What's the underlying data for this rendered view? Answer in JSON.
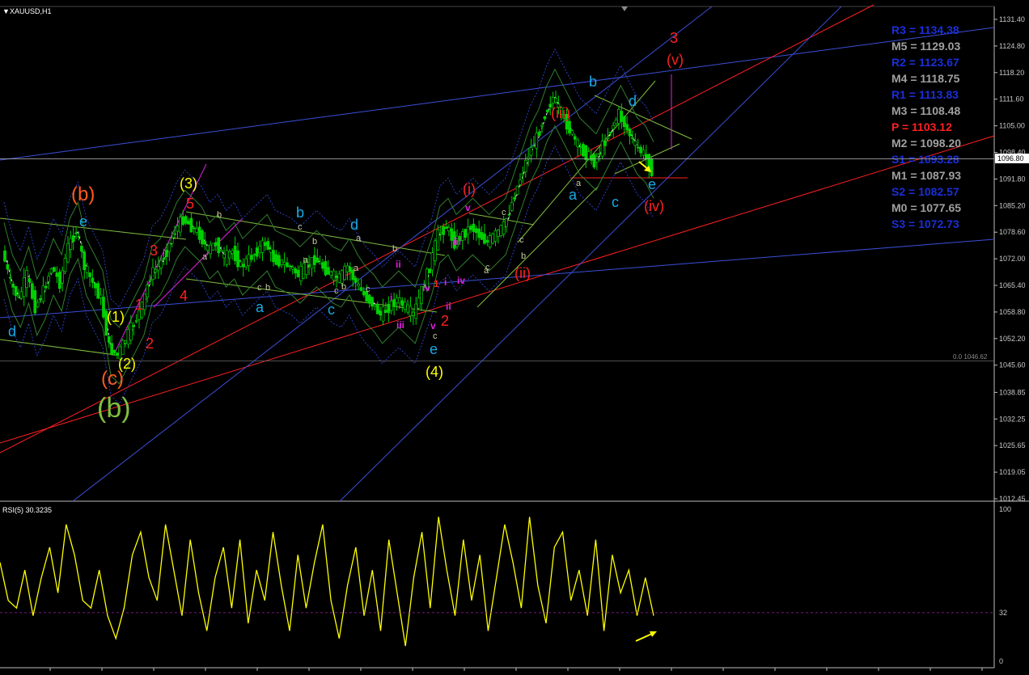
{
  "chart_data": [
    {
      "type": "line",
      "title": "XAUUSD,H1",
      "ylim": [
        1010,
        1136
      ],
      "y_ticks": [
        "1131.40",
        "1124.80",
        "1118.20",
        "1111.60",
        "1105.00",
        "1098.40",
        "1091.80",
        "1085.20",
        "1078.60",
        "1072.00",
        "1065.40",
        "1058.80",
        "1052.20",
        "1045.60",
        "1038.85",
        "1032.25",
        "1025.65",
        "1019.05",
        "1012.45"
      ],
      "current_price_label": "1096.80",
      "current_price": 1096.8,
      "level_marker": "0.0 1046.62",
      "level_value": 1046.62,
      "pivot_levels": [
        {
          "label": "R3 = 1134.38",
          "value": 1134.38,
          "color": "#1a2fd8"
        },
        {
          "label": "M5 = 1129.03",
          "value": 1129.03,
          "color": "#a0a0a0"
        },
        {
          "label": "R2 = 1123.67",
          "value": 1123.67,
          "color": "#1a2fd8"
        },
        {
          "label": "M4 = 1118.75",
          "value": 1118.75,
          "color": "#a0a0a0"
        },
        {
          "label": "R1 = 1113.83",
          "value": 1113.83,
          "color": "#1a2fd8"
        },
        {
          "label": "M3 = 1108.48",
          "value": 1108.48,
          "color": "#a0a0a0"
        },
        {
          "label": "P  = 1103.12",
          "value": 1103.12,
          "color": "#ff2020"
        },
        {
          "label": "M2 = 1098.20",
          "value": 1098.2,
          "color": "#a0a0a0"
        },
        {
          "label": "S1 = 1093.28",
          "value": 1093.28,
          "color": "#1a2fd8"
        },
        {
          "label": "M1 = 1087.93",
          "value": 1087.93,
          "color": "#a0a0a0"
        },
        {
          "label": "S2 = 1082.57",
          "value": 1082.57,
          "color": "#1a2fd8"
        },
        {
          "label": "M0 = 1077.65",
          "value": 1077.65,
          "color": "#a0a0a0"
        },
        {
          "label": "S3 = 1072.73",
          "value": 1072.73,
          "color": "#1a2fd8"
        }
      ],
      "price_path": [
        1074,
        1066,
        1062,
        1068,
        1060,
        1064,
        1070,
        1066,
        1075,
        1079,
        1070,
        1066,
        1062,
        1050,
        1048,
        1052,
        1056,
        1060,
        1068,
        1070,
        1074,
        1079,
        1082,
        1080,
        1078,
        1074,
        1076,
        1072,
        1074,
        1070,
        1072,
        1074,
        1076,
        1072,
        1071,
        1070,
        1068,
        1070,
        1072,
        1070,
        1068,
        1067,
        1070,
        1066,
        1063,
        1061,
        1058,
        1060,
        1062,
        1060,
        1058,
        1064,
        1070,
        1078,
        1080,
        1076,
        1078,
        1080,
        1078,
        1076,
        1078,
        1080,
        1086,
        1092,
        1098,
        1102,
        1108,
        1112,
        1108,
        1104,
        1100,
        1098,
        1096,
        1100,
        1104,
        1108,
        1104,
        1100,
        1098,
        1094
      ],
      "colors": {
        "candles": "#00d000",
        "wave_red": "#ff2020",
        "wave_yellow": "#ffff00",
        "wave_blue": "#19a9e6",
        "wave_magenta": "#e020e0",
        "wave_green": "#7fbf3f"
      },
      "wave_labels": [
        {
          "text": "(b)",
          "color": "#ff5a1a",
          "size": "big"
        },
        {
          "text": "e",
          "color": "#19a9e6",
          "size": "mid"
        },
        {
          "text": "d",
          "color": "#19a9e6",
          "size": "mid"
        },
        {
          "text": "(1)",
          "color": "#ffff00",
          "size": "mid"
        },
        {
          "text": "(2)",
          "color": "#ffff00",
          "size": "mid"
        },
        {
          "text": "(c)",
          "color": "#ff5a1a",
          "size": "big"
        },
        {
          "text": "(b)",
          "color": "#7fbf3f",
          "size": "huge"
        },
        {
          "text": "(3)",
          "color": "#ffff00",
          "size": "mid"
        },
        {
          "text": "5",
          "color": "#ff2020",
          "size": "mid"
        },
        {
          "text": "3",
          "color": "#ff2020",
          "size": "mid"
        },
        {
          "text": "4",
          "color": "#ff2020",
          "size": "mid"
        },
        {
          "text": "2",
          "color": "#ff2020",
          "size": "mid"
        },
        {
          "text": "1",
          "color": "#ff2020",
          "size": "mid"
        },
        {
          "text": "b",
          "color": "#19a9e6",
          "size": "mid"
        },
        {
          "text": "a",
          "color": "#19a9e6",
          "size": "mid"
        },
        {
          "text": "c",
          "color": "#19a9e6",
          "size": "mid"
        },
        {
          "text": "d",
          "color": "#19a9e6",
          "size": "mid"
        },
        {
          "text": "e",
          "color": "#19a9e6",
          "size": "mid"
        },
        {
          "text": "(4)",
          "color": "#ffff00",
          "size": "mid"
        },
        {
          "text": "(i)",
          "color": "#ff2020",
          "size": "mid"
        },
        {
          "text": "v",
          "color": "#e020e0",
          "size": "small"
        },
        {
          "text": "iii",
          "color": "#e020e0",
          "size": "small"
        },
        {
          "text": "iv",
          "color": "#e020e0",
          "size": "small"
        },
        {
          "text": "ii",
          "color": "#e020e0",
          "size": "small"
        },
        {
          "text": "i",
          "color": "#e020e0",
          "size": "small"
        },
        {
          "text": "iii",
          "color": "#e020e0",
          "size": "small"
        },
        {
          "text": "iv",
          "color": "#e020e0",
          "size": "small"
        },
        {
          "text": "ii",
          "color": "#e020e0",
          "size": "small"
        },
        {
          "text": "i",
          "color": "#e020e0",
          "size": "small"
        },
        {
          "text": "v",
          "color": "#e020e0",
          "size": "small"
        },
        {
          "text": "1",
          "color": "#ff2020",
          "size": "small"
        },
        {
          "text": "2",
          "color": "#ff2020",
          "size": "mid"
        },
        {
          "text": "(ii)",
          "color": "#ff2020",
          "size": "mid"
        },
        {
          "text": "(iii)",
          "color": "#ff2020",
          "size": "mid"
        },
        {
          "text": "b",
          "color": "#19a9e6",
          "size": "mid"
        },
        {
          "text": "a",
          "color": "#19a9e6",
          "size": "mid"
        },
        {
          "text": "c",
          "color": "#19a9e6",
          "size": "mid"
        },
        {
          "text": "d",
          "color": "#19a9e6",
          "size": "mid"
        },
        {
          "text": "e",
          "color": "#19a9e6",
          "size": "mid"
        },
        {
          "text": "(iv)",
          "color": "#ff2020",
          "size": "mid"
        },
        {
          "text": "(v)",
          "color": "#ff2020",
          "size": "mid"
        },
        {
          "text": "3",
          "color": "#ff2020",
          "size": "mid"
        }
      ],
      "minor_labels": [
        "b",
        "a",
        "c",
        "b",
        "a",
        "c",
        "b",
        "c",
        "b",
        "a",
        "c",
        "b",
        "a",
        "c",
        "a",
        "c",
        "b",
        "c",
        "a",
        "c"
      ]
    },
    {
      "type": "line",
      "title": "RSI(5) 30.3235",
      "ylim": [
        0,
        100
      ],
      "y_ticks": [
        "100",
        "32",
        "0"
      ],
      "level": 32,
      "values": [
        65,
        40,
        35,
        60,
        30,
        55,
        75,
        45,
        90,
        70,
        40,
        35,
        60,
        30,
        15,
        35,
        70,
        85,
        55,
        40,
        90,
        60,
        30,
        80,
        45,
        20,
        55,
        75,
        35,
        80,
        25,
        60,
        40,
        85,
        50,
        20,
        70,
        35,
        65,
        90,
        40,
        15,
        50,
        75,
        30,
        60,
        20,
        80,
        45,
        10,
        55,
        85,
        35,
        95,
        60,
        30,
        80,
        40,
        70,
        20,
        55,
        90,
        65,
        35,
        95,
        50,
        25,
        75,
        85,
        40,
        60,
        30,
        80,
        20,
        70,
        45,
        60,
        30,
        55,
        30
      ]
    }
  ]
}
